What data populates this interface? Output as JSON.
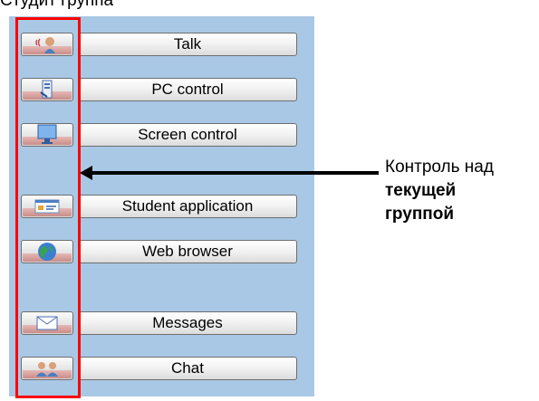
{
  "top_caption": "Студит группа",
  "toolbar": {
    "items": [
      {
        "label": "Talk",
        "icon": "talk-icon"
      },
      {
        "label": "PC control",
        "icon": "pc-control-icon"
      },
      {
        "label": "Screen control",
        "icon": "screen-control-icon"
      },
      {
        "label": "Student application",
        "icon": "student-application-icon"
      },
      {
        "label": "Web browser",
        "icon": "web-browser-icon"
      },
      {
        "label": "Messages",
        "icon": "messages-icon"
      },
      {
        "label": "Chat",
        "icon": "chat-icon"
      }
    ]
  },
  "annotation": {
    "line1": "Контроль над",
    "line2": "текущей",
    "line3": "группой",
    "highlight_color": "#ff0000"
  },
  "colors": {
    "panel_background": "#a9c8e6"
  }
}
